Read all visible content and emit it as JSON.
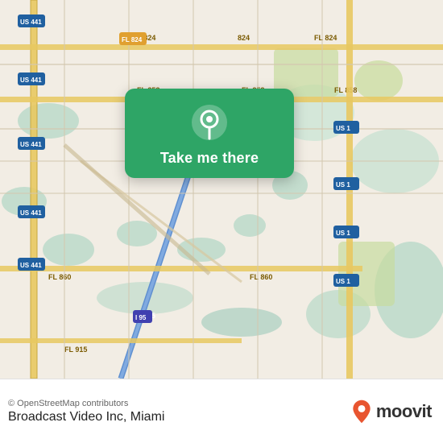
{
  "map": {
    "attribution": "© OpenStreetMap contributors",
    "background_color": "#e8e0d8"
  },
  "card": {
    "label": "Take me there",
    "bg_color": "#2ea566"
  },
  "bottom_bar": {
    "location_name": "Broadcast Video Inc, Miami",
    "moovit_label": "moovit",
    "attribution": "© OpenStreetMap contributors"
  }
}
